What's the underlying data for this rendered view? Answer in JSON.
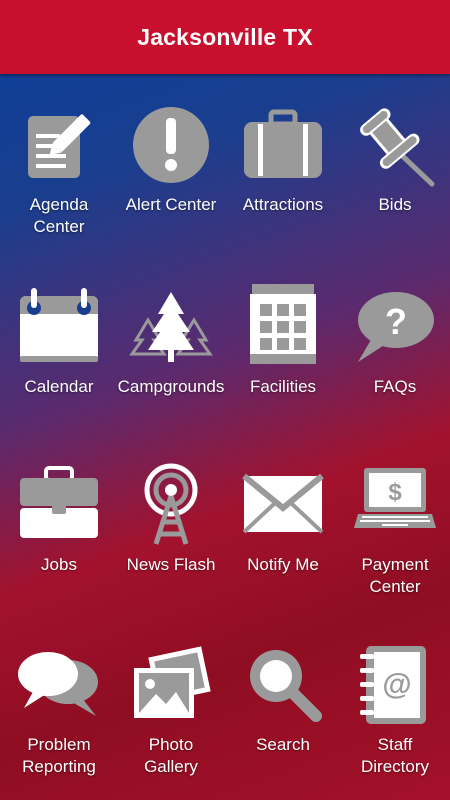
{
  "header": {
    "title": "Jacksonville TX"
  },
  "tiles": [
    {
      "label": "Agenda\nCenter",
      "icon": "agenda-icon"
    },
    {
      "label": "Alert Center",
      "icon": "alert-icon"
    },
    {
      "label": "Attractions",
      "icon": "suitcase-icon"
    },
    {
      "label": "Bids",
      "icon": "pushpin-icon"
    },
    {
      "label": "Calendar",
      "icon": "calendar-icon"
    },
    {
      "label": "Campgrounds",
      "icon": "pine-trees-icon"
    },
    {
      "label": "Facilities",
      "icon": "building-icon"
    },
    {
      "label": "FAQs",
      "icon": "question-bubble-icon"
    },
    {
      "label": "Jobs",
      "icon": "briefcase-icon"
    },
    {
      "label": "News Flash",
      "icon": "broadcast-tower-icon"
    },
    {
      "label": "Notify Me",
      "icon": "envelope-icon"
    },
    {
      "label": "Payment\nCenter",
      "icon": "laptop-dollar-icon"
    },
    {
      "label": "Problem\nReporting",
      "icon": "chat-bubbles-icon"
    },
    {
      "label": "Photo\nGallery",
      "icon": "photos-icon"
    },
    {
      "label": "Search",
      "icon": "magnifier-icon"
    },
    {
      "label": "Staff\nDirectory",
      "icon": "address-book-icon"
    }
  ],
  "colors": {
    "header": "#c8102e",
    "icon_gray": "#9a9a9a",
    "icon_white": "#ffffff",
    "label": "#ffffff"
  }
}
